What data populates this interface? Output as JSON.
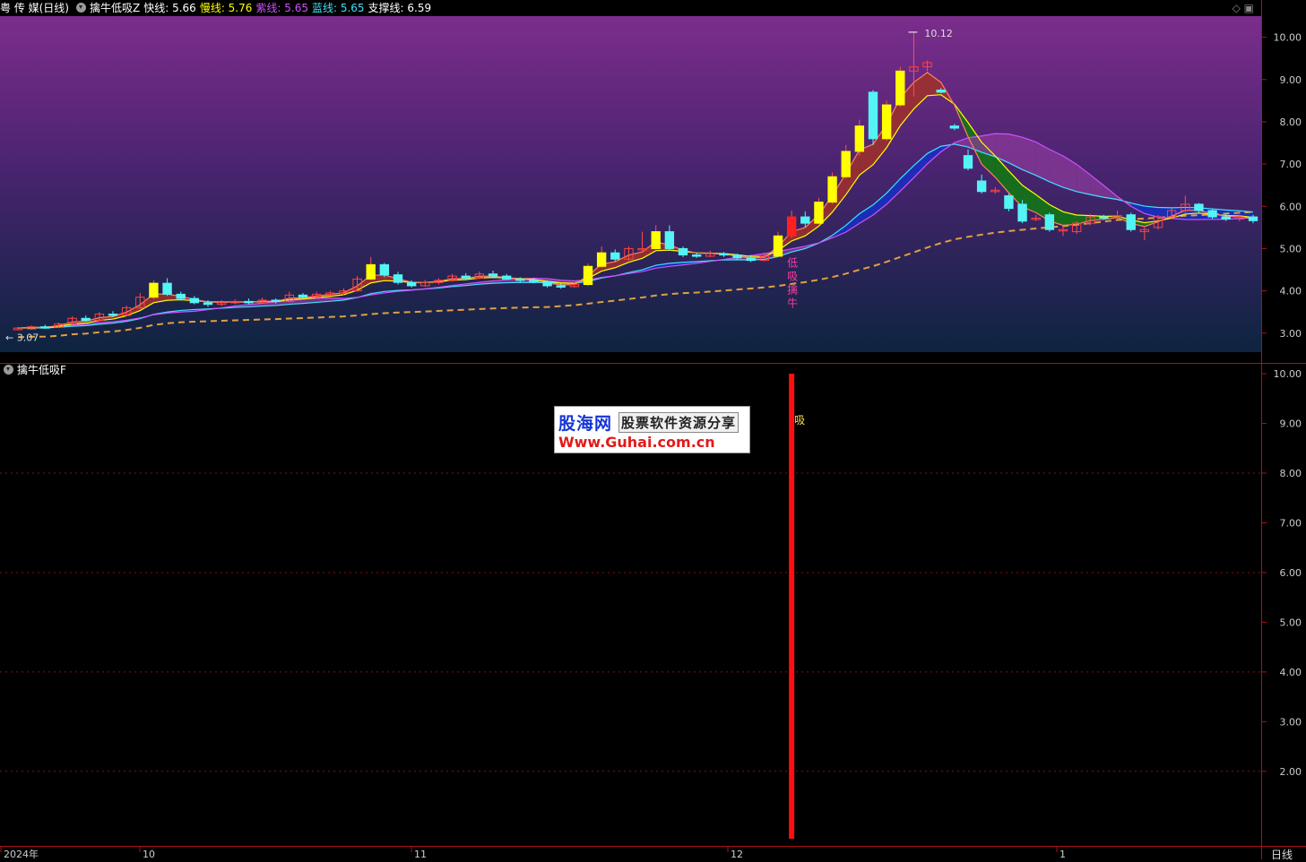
{
  "header": {
    "stock": "粤 传 媒(日线)",
    "indicator": "擒牛低吸Z",
    "items": [
      {
        "label": "快线: 5.66",
        "color": "#ffffff"
      },
      {
        "label": "慢线: 5.76",
        "color": "#ffff00"
      },
      {
        "label": "紫线: 5.65",
        "color": "#d050ff"
      },
      {
        "label": "蓝线: 5.65",
        "color": "#40e0ff"
      },
      {
        "label": "支撑线: 6.59",
        "color": "#ffffff"
      }
    ],
    "controls": "◇ ▣"
  },
  "lower_panel": {
    "title": "擒牛低吸F"
  },
  "watermark": {
    "brand": "股海网",
    "tagline": "股票软件资源分享",
    "url": "Www.Guhai.com.cn"
  },
  "period_label": "日线",
  "chart_data": [
    {
      "type": "candlestick",
      "ylim": [
        2.55,
        10.5
      ],
      "yticks": [
        "10.00",
        "9.00",
        "8.00",
        "7.00",
        "6.00",
        "5.00",
        "4.00",
        "3.00"
      ],
      "x_labels": [
        "2024年",
        "10",
        "11",
        "12",
        "1"
      ],
      "annotations": {
        "high_label": "10.12",
        "low_label": "3.07",
        "signal_text": "低吸擒牛"
      },
      "candles": [
        [
          3.08,
          3.12,
          3.07,
          3.15
        ],
        [
          3.1,
          3.15,
          3.08,
          3.18
        ],
        [
          3.15,
          3.14,
          3.1,
          3.2
        ],
        [
          3.14,
          3.22,
          3.12,
          3.25
        ],
        [
          3.22,
          3.35,
          3.2,
          3.4
        ],
        [
          3.35,
          3.3,
          3.27,
          3.42
        ],
        [
          3.3,
          3.45,
          3.28,
          3.5
        ],
        [
          3.45,
          3.42,
          3.38,
          3.52
        ],
        [
          3.42,
          3.6,
          3.4,
          3.65
        ],
        [
          3.6,
          3.85,
          3.58,
          3.95
        ],
        [
          3.85,
          4.18,
          3.8,
          4.25
        ],
        [
          4.18,
          3.92,
          3.88,
          4.3
        ],
        [
          3.92,
          3.82,
          3.78,
          3.98
        ],
        [
          3.82,
          3.72,
          3.68,
          3.88
        ],
        [
          3.72,
          3.68,
          3.62,
          3.78
        ],
        [
          3.68,
          3.72,
          3.64,
          3.78
        ],
        [
          3.72,
          3.75,
          3.68,
          3.8
        ],
        [
          3.75,
          3.72,
          3.68,
          3.82
        ],
        [
          3.72,
          3.78,
          3.7,
          3.84
        ],
        [
          3.78,
          3.75,
          3.7,
          3.82
        ],
        [
          3.75,
          3.9,
          3.72,
          3.98
        ],
        [
          3.9,
          3.85,
          3.8,
          3.95
        ],
        [
          3.85,
          3.92,
          3.82,
          3.98
        ],
        [
          3.92,
          3.95,
          3.88,
          4.0
        ],
        [
          3.95,
          4.0,
          3.9,
          4.06
        ],
        [
          4.0,
          4.28,
          3.98,
          4.35
        ],
        [
          4.28,
          4.62,
          4.25,
          4.8
        ],
        [
          4.62,
          4.38,
          4.32,
          4.66
        ],
        [
          4.38,
          4.2,
          4.15,
          4.45
        ],
        [
          4.2,
          4.12,
          4.08,
          4.25
        ],
        [
          4.12,
          4.2,
          4.1,
          4.26
        ],
        [
          4.2,
          4.25,
          4.15,
          4.3
        ],
        [
          4.25,
          4.35,
          4.22,
          4.4
        ],
        [
          4.35,
          4.3,
          4.25,
          4.42
        ],
        [
          4.3,
          4.4,
          4.28,
          4.46
        ],
        [
          4.4,
          4.35,
          4.3,
          4.48
        ],
        [
          4.35,
          4.28,
          4.25,
          4.4
        ],
        [
          4.28,
          4.25,
          4.2,
          4.32
        ],
        [
          4.25,
          4.22,
          4.18,
          4.3
        ],
        [
          4.22,
          4.12,
          4.08,
          4.25
        ],
        [
          4.12,
          4.1,
          4.05,
          4.18
        ],
        [
          4.1,
          4.15,
          4.08,
          4.2
        ],
        [
          4.15,
          4.58,
          4.12,
          4.65
        ],
        [
          4.58,
          4.9,
          4.55,
          5.05
        ],
        [
          4.9,
          4.75,
          4.7,
          4.98
        ],
        [
          4.75,
          5.0,
          4.72,
          5.05
        ],
        [
          5.0,
          5.0,
          4.95,
          5.4
        ],
        [
          5.0,
          5.4,
          4.98,
          5.55
        ],
        [
          5.4,
          5.0,
          4.95,
          5.55
        ],
        [
          5.0,
          4.85,
          4.8,
          5.05
        ],
        [
          4.85,
          4.82,
          4.78,
          4.9
        ],
        [
          4.82,
          4.88,
          4.8,
          4.95
        ],
        [
          4.88,
          4.85,
          4.8,
          4.92
        ],
        [
          4.85,
          4.78,
          4.74,
          4.88
        ],
        [
          4.78,
          4.72,
          4.68,
          4.85
        ],
        [
          4.72,
          4.82,
          4.7,
          4.9
        ],
        [
          4.82,
          5.3,
          4.8,
          5.4
        ],
        [
          5.3,
          5.75,
          5.25,
          5.9
        ],
        [
          5.75,
          5.6,
          5.5,
          5.88
        ],
        [
          5.6,
          6.1,
          5.58,
          6.2
        ],
        [
          6.1,
          6.7,
          6.05,
          6.8
        ],
        [
          6.7,
          7.3,
          6.65,
          7.45
        ],
        [
          7.3,
          7.9,
          7.2,
          8.05
        ],
        [
          8.7,
          7.6,
          7.45,
          8.75
        ],
        [
          7.6,
          8.4,
          7.55,
          8.5
        ],
        [
          8.4,
          9.2,
          8.35,
          9.3
        ],
        [
          9.2,
          9.3,
          8.6,
          10.12
        ],
        [
          9.3,
          9.4,
          9.2,
          9.45
        ],
        [
          8.75,
          8.7,
          8.68,
          8.8
        ],
        [
          7.9,
          7.85,
          7.8,
          7.95
        ],
        [
          7.2,
          6.9,
          6.85,
          7.35
        ],
        [
          6.6,
          6.35,
          6.3,
          6.75
        ],
        [
          6.35,
          6.38,
          6.3,
          6.45
        ],
        [
          6.25,
          5.95,
          5.88,
          6.3
        ],
        [
          6.05,
          5.65,
          5.6,
          6.15
        ],
        [
          5.7,
          5.72,
          5.65,
          5.8
        ],
        [
          5.8,
          5.45,
          5.4,
          5.85
        ],
        [
          5.45,
          5.45,
          5.3,
          5.55
        ],
        [
          5.4,
          5.6,
          5.35,
          5.65
        ],
        [
          5.6,
          5.75,
          5.55,
          5.82
        ],
        [
          5.75,
          5.72,
          5.68,
          5.8
        ],
        [
          5.75,
          5.78,
          5.7,
          5.9
        ],
        [
          5.8,
          5.45,
          5.4,
          5.85
        ],
        [
          5.4,
          5.45,
          5.2,
          5.5
        ],
        [
          5.5,
          5.75,
          5.45,
          5.8
        ],
        [
          5.75,
          5.9,
          5.7,
          5.95
        ],
        [
          5.9,
          6.05,
          5.85,
          6.25
        ],
        [
          6.05,
          5.9,
          5.85,
          6.08
        ],
        [
          5.9,
          5.75,
          5.7,
          5.95
        ],
        [
          5.75,
          5.7,
          5.65,
          5.82
        ],
        [
          5.7,
          5.75,
          5.65,
          5.8
        ],
        [
          5.75,
          5.66,
          5.6,
          5.8
        ]
      ]
    },
    {
      "type": "bar",
      "ylim": [
        0.5,
        10.2
      ],
      "yticks": [
        "10.00",
        "9.00",
        "8.00",
        "7.00",
        "6.00",
        "5.00",
        "4.00",
        "3.00",
        "2.00"
      ],
      "signal_index": 57,
      "signal_value": 10.0,
      "signal_label": "吸"
    }
  ]
}
